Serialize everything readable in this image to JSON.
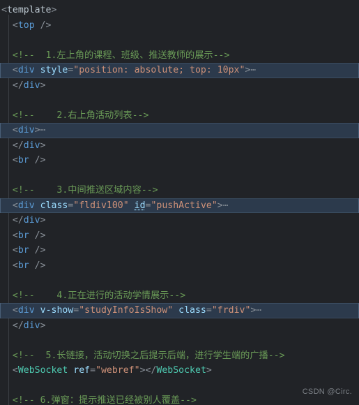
{
  "editor": {
    "language": "vue-html",
    "background_color": "#212327",
    "highlight_color": "#2c3a4c",
    "colors": {
      "punctuation": "#8a9199",
      "tag": "#5b9bd5",
      "root_tag": "#b8c3cc",
      "component_tag": "#4ec9b0",
      "attribute": "#9cdcfe",
      "string": "#ce9178",
      "comment": "#6a9b57",
      "fold_marker": "#7d868f"
    },
    "fold_marker": "⋯"
  },
  "watermark": {
    "text": "CSDN @Circ."
  },
  "code": {
    "lines": [
      {
        "n": 1,
        "indent": 0,
        "highlighted": false,
        "tokens": [
          {
            "t": "punc",
            "v": "<"
          },
          {
            "t": "tag-root",
            "v": "template"
          },
          {
            "t": "punc",
            "v": ">"
          }
        ]
      },
      {
        "n": 2,
        "indent": 1,
        "highlighted": false,
        "tokens": [
          {
            "t": "punc",
            "v": "<"
          },
          {
            "t": "tag",
            "v": "top"
          },
          {
            "t": "punc",
            "v": " />"
          }
        ]
      },
      {
        "n": 3,
        "indent": 0,
        "highlighted": false,
        "tokens": []
      },
      {
        "n": 4,
        "indent": 1,
        "highlighted": false,
        "tokens": [
          {
            "t": "cmt",
            "v": "<!--  1.左上角的课程、班级、推送教师的展示-->"
          }
        ]
      },
      {
        "n": 5,
        "indent": 1,
        "highlighted": true,
        "tokens": [
          {
            "t": "punc",
            "v": "<"
          },
          {
            "t": "tag",
            "v": "div"
          },
          {
            "t": "punc",
            "v": " "
          },
          {
            "t": "attr",
            "v": "style"
          },
          {
            "t": "punc",
            "v": "="
          },
          {
            "t": "str",
            "v": "\"position: absolute; top: 10px\""
          },
          {
            "t": "punc",
            "v": ">"
          },
          {
            "t": "fold",
            "v": "⋯"
          }
        ]
      },
      {
        "n": 6,
        "indent": 1,
        "highlighted": false,
        "tokens": [
          {
            "t": "punc",
            "v": "</"
          },
          {
            "t": "tag",
            "v": "div"
          },
          {
            "t": "punc",
            "v": ">"
          }
        ]
      },
      {
        "n": 7,
        "indent": 0,
        "highlighted": false,
        "tokens": []
      },
      {
        "n": 8,
        "indent": 1,
        "highlighted": false,
        "tokens": [
          {
            "t": "cmt",
            "v": "<!--    2.右上角活动列表-->"
          }
        ]
      },
      {
        "n": 9,
        "indent": 1,
        "highlighted": true,
        "tokens": [
          {
            "t": "punc",
            "v": "<"
          },
          {
            "t": "tag",
            "v": "div"
          },
          {
            "t": "punc",
            "v": ">"
          },
          {
            "t": "fold",
            "v": "⋯"
          }
        ]
      },
      {
        "n": 10,
        "indent": 1,
        "highlighted": false,
        "tokens": [
          {
            "t": "punc",
            "v": "</"
          },
          {
            "t": "tag",
            "v": "div"
          },
          {
            "t": "punc",
            "v": ">"
          }
        ]
      },
      {
        "n": 11,
        "indent": 1,
        "highlighted": false,
        "tokens": [
          {
            "t": "punc",
            "v": "<"
          },
          {
            "t": "tag",
            "v": "br"
          },
          {
            "t": "punc",
            "v": " />"
          }
        ]
      },
      {
        "n": 12,
        "indent": 0,
        "highlighted": false,
        "tokens": []
      },
      {
        "n": 13,
        "indent": 1,
        "highlighted": false,
        "tokens": [
          {
            "t": "cmt",
            "v": "<!--    3.中间推送区域内容-->"
          }
        ]
      },
      {
        "n": 14,
        "indent": 1,
        "highlighted": true,
        "tokens": [
          {
            "t": "punc",
            "v": "<"
          },
          {
            "t": "tag",
            "v": "div"
          },
          {
            "t": "punc",
            "v": " "
          },
          {
            "t": "attr",
            "v": "class"
          },
          {
            "t": "punc",
            "v": "="
          },
          {
            "t": "str",
            "v": "\"fldiv100\""
          },
          {
            "t": "punc",
            "v": " "
          },
          {
            "t": "attr-u",
            "v": "id"
          },
          {
            "t": "punc",
            "v": "="
          },
          {
            "t": "str",
            "v": "\"pushActive\""
          },
          {
            "t": "punc",
            "v": ">"
          },
          {
            "t": "fold",
            "v": "⋯"
          }
        ]
      },
      {
        "n": 15,
        "indent": 1,
        "highlighted": false,
        "tokens": [
          {
            "t": "punc",
            "v": "</"
          },
          {
            "t": "tag",
            "v": "div"
          },
          {
            "t": "punc",
            "v": ">"
          }
        ]
      },
      {
        "n": 16,
        "indent": 1,
        "highlighted": false,
        "tokens": [
          {
            "t": "punc",
            "v": "<"
          },
          {
            "t": "tag",
            "v": "br"
          },
          {
            "t": "punc",
            "v": " />"
          }
        ]
      },
      {
        "n": 17,
        "indent": 1,
        "highlighted": false,
        "tokens": [
          {
            "t": "punc",
            "v": "<"
          },
          {
            "t": "tag",
            "v": "br"
          },
          {
            "t": "punc",
            "v": " />"
          }
        ]
      },
      {
        "n": 18,
        "indent": 1,
        "highlighted": false,
        "tokens": [
          {
            "t": "punc",
            "v": "<"
          },
          {
            "t": "tag",
            "v": "br"
          },
          {
            "t": "punc",
            "v": " />"
          }
        ]
      },
      {
        "n": 19,
        "indent": 0,
        "highlighted": false,
        "tokens": []
      },
      {
        "n": 20,
        "indent": 1,
        "highlighted": false,
        "tokens": [
          {
            "t": "cmt",
            "v": "<!--    4.正在进行的活动学情展示-->"
          }
        ]
      },
      {
        "n": 21,
        "indent": 1,
        "highlighted": true,
        "tokens": [
          {
            "t": "punc",
            "v": "<"
          },
          {
            "t": "tag",
            "v": "div"
          },
          {
            "t": "punc",
            "v": " "
          },
          {
            "t": "attr",
            "v": "v-show"
          },
          {
            "t": "punc",
            "v": "="
          },
          {
            "t": "str",
            "v": "\"studyInfoIsShow\""
          },
          {
            "t": "punc",
            "v": " "
          },
          {
            "t": "attr",
            "v": "class"
          },
          {
            "t": "punc",
            "v": "="
          },
          {
            "t": "str",
            "v": "\"frdiv\""
          },
          {
            "t": "punc",
            "v": ">"
          },
          {
            "t": "fold",
            "v": "⋯"
          }
        ]
      },
      {
        "n": 22,
        "indent": 1,
        "highlighted": false,
        "tokens": [
          {
            "t": "punc",
            "v": "</"
          },
          {
            "t": "tag",
            "v": "div"
          },
          {
            "t": "punc",
            "v": ">"
          }
        ]
      },
      {
        "n": 23,
        "indent": 0,
        "highlighted": false,
        "tokens": []
      },
      {
        "n": 24,
        "indent": 1,
        "highlighted": false,
        "tokens": [
          {
            "t": "cmt",
            "v": "<!--  5.长链接，活动切换之后提示后端，进行学生端的广播-->"
          }
        ]
      },
      {
        "n": 25,
        "indent": 1,
        "highlighted": false,
        "tokens": [
          {
            "t": "punc",
            "v": "<"
          },
          {
            "t": "tag-comp",
            "v": "WebSocket"
          },
          {
            "t": "punc",
            "v": " "
          },
          {
            "t": "attr",
            "v": "ref"
          },
          {
            "t": "punc",
            "v": "="
          },
          {
            "t": "str",
            "v": "\"webref\""
          },
          {
            "t": "punc",
            "v": ">"
          },
          {
            "t": "punc",
            "v": "</"
          },
          {
            "t": "tag-comp",
            "v": "WebSocket"
          },
          {
            "t": "punc",
            "v": ">"
          }
        ]
      },
      {
        "n": 26,
        "indent": 0,
        "highlighted": false,
        "tokens": []
      },
      {
        "n": 27,
        "indent": 1,
        "highlighted": false,
        "tokens": [
          {
            "t": "cmt",
            "v": "<!-- 6.弹窗：提示推送已经被别人覆盖-->"
          }
        ]
      }
    ]
  }
}
